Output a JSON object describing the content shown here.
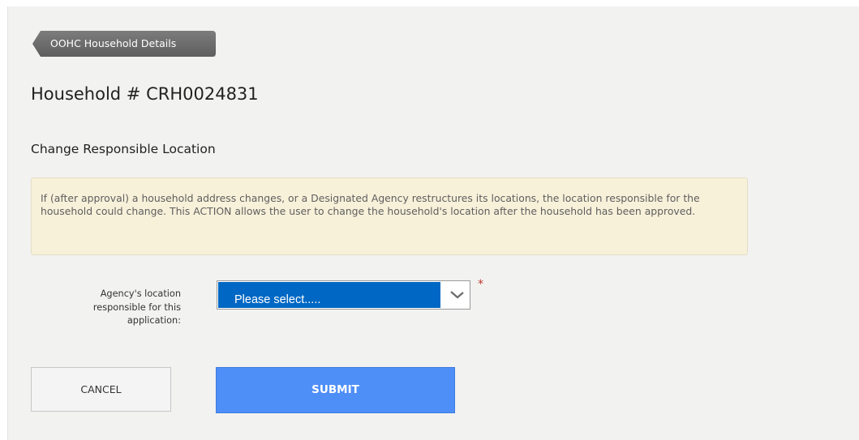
{
  "header": {
    "back_button_label": "OOHC Household Details",
    "title": "Household # CRH0024831",
    "section_title": "Change Responsible Location"
  },
  "info": {
    "text": "If (after approval) a household address changes, or a Designated Agency restructures its locations, the location responsible for the household could change. This ACTION allows the user to change the household's location after the household has been approved."
  },
  "form": {
    "location_label": "Agency's location responsible for this application:",
    "location_selected": "Please select.....",
    "required_marker": "*"
  },
  "actions": {
    "cancel_label": "CANCEL",
    "submit_label": "SUBMIT"
  },
  "colors": {
    "accent": "#4e8ef7",
    "selected": "#0068c4",
    "info_background": "#f8f1da",
    "required": "#c0392b"
  },
  "icons": {
    "back": "back-arrow-tab-icon",
    "dropdown": "chevron-down-icon"
  }
}
